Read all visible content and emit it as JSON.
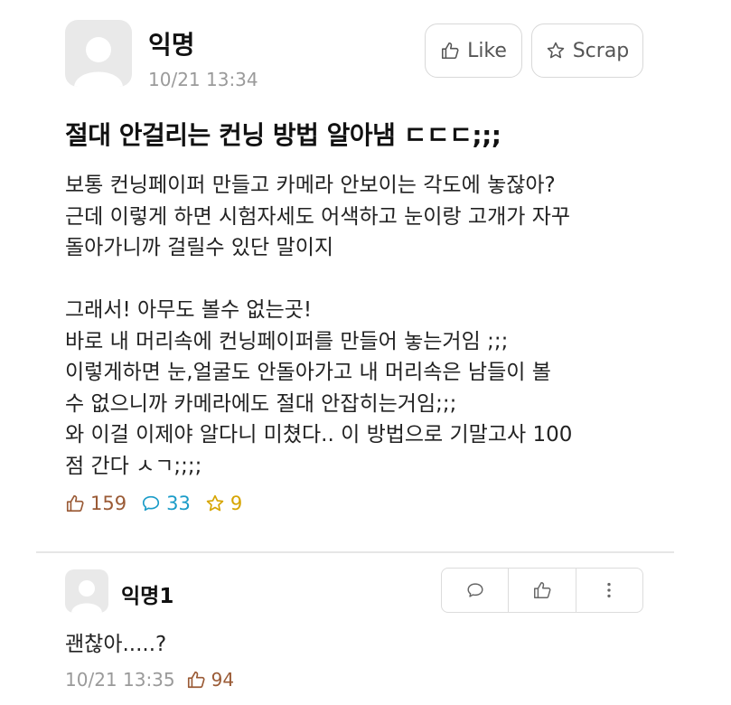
{
  "post": {
    "author": "익명",
    "timestamp": "10/21 13:34",
    "like_button_label": "Like",
    "scrap_button_label": "Scrap",
    "title": "절대 안걸리는 컨닝 방법 알아냄 ㄷㄷㄷ;;;",
    "body": "보통 컨닝페이퍼 만들고 카메라 안보이는 각도에 놓잖아?\n근데 이렇게 하면 시험자세도 어색하고 눈이랑 고개가 자꾸\n돌아가니까 걸릴수 있단 말이지\n\n그래서! 아무도 볼수 없는곳!\n바로 내 머리속에 컨닝페이퍼를 만들어 놓는거임 ;;;\n이렇게하면 눈,얼굴도 안돌아가고 내 머리속은 남들이 볼\n수 없으니까 카메라에도 절대 안잡히는거임;;;\n와 이걸 이제야 알다니 미쳤다.. 이 방법으로 기말고사 100\n점 간다 ㅅㄱ;;;;",
    "like_count": "159",
    "comment_count": "33",
    "scrap_count": "9"
  },
  "comment": {
    "author": "익명1",
    "text": "괜찮아.....?",
    "timestamp": "10/21 13:35",
    "like_count": "94"
  },
  "icons": {
    "avatar": "user-silhouette-icon",
    "like": "thumbs-up-icon",
    "scrap": "star-icon",
    "comment": "speech-bubble-icon",
    "more": "vertical-dots-icon"
  },
  "colors": {
    "like_accent": "#9a5a35",
    "comment_accent": "#1b9cc8",
    "scrap_accent": "#d6a400",
    "muted_text": "#9a9a9a",
    "border": "#d8d8d8"
  }
}
